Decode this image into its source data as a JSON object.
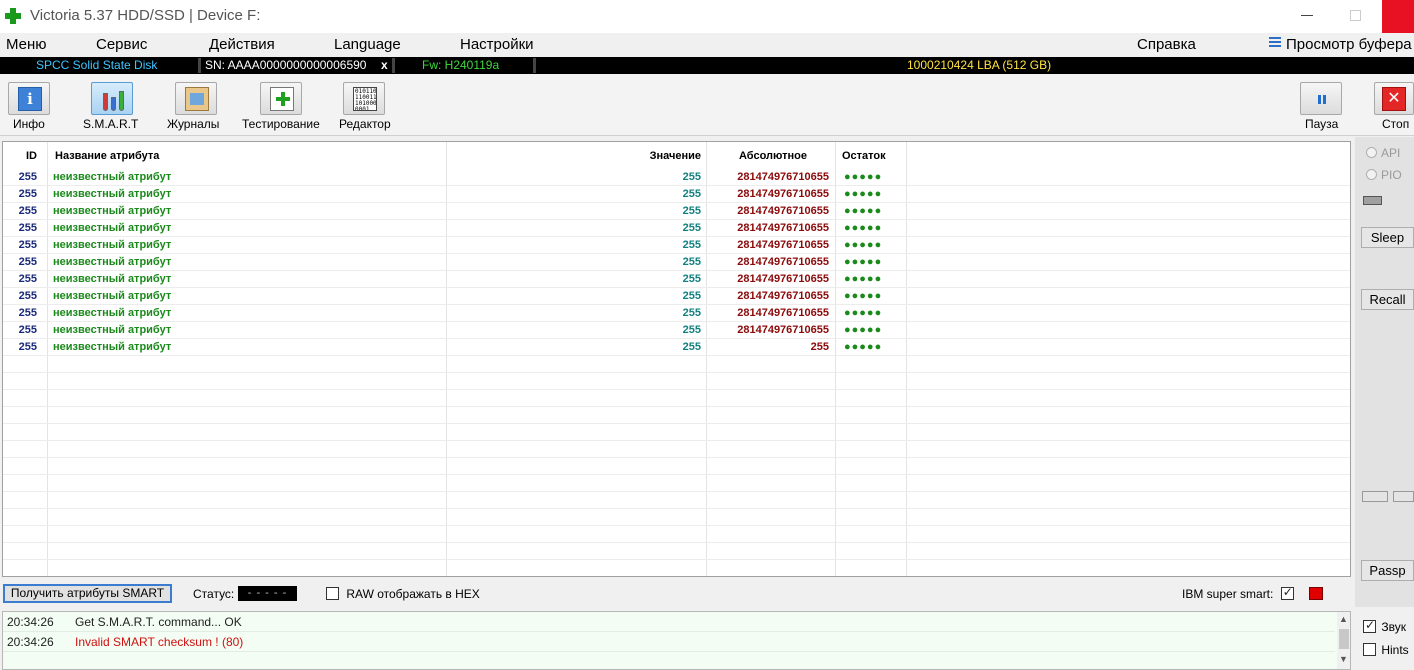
{
  "window": {
    "title": "Victoria 5.37 HDD/SSD | Device F:"
  },
  "menu": {
    "items": [
      "Меню",
      "Сервис",
      "Действия",
      "Language",
      "Настройки",
      "Справка"
    ],
    "buffer_view": "Просмотр буфера"
  },
  "device": {
    "model": "SPCC Solid State Disk",
    "serial": "SN: AAAA0000000000006590",
    "close": "x",
    "firmware": "Fw: H240119a",
    "capacity": "1000210424 LBA (512 GB)"
  },
  "toolbar": {
    "info": "Инфо",
    "smart": "S.M.A.R.T",
    "journals": "Журналы",
    "testing": "Тестирование",
    "editor": "Редактор",
    "pause": "Пауза",
    "stop": "Стоп",
    "info_glyph": "i",
    "editor_glyph": "010110 110011 101000 0001",
    "stop_glyph": "✕"
  },
  "table": {
    "headers": {
      "id": "ID",
      "name": "Название атрибута",
      "value": "Значение",
      "absolute": "Абсолютное",
      "remainder": "Остаток"
    },
    "rows": [
      {
        "id": "255",
        "name": "неизвестный атрибут",
        "value": "255",
        "absolute": "281474976710655",
        "remainder": "●●●●●"
      },
      {
        "id": "255",
        "name": "неизвестный атрибут",
        "value": "255",
        "absolute": "281474976710655",
        "remainder": "●●●●●"
      },
      {
        "id": "255",
        "name": "неизвестный атрибут",
        "value": "255",
        "absolute": "281474976710655",
        "remainder": "●●●●●"
      },
      {
        "id": "255",
        "name": "неизвестный атрибут",
        "value": "255",
        "absolute": "281474976710655",
        "remainder": "●●●●●"
      },
      {
        "id": "255",
        "name": "неизвестный атрибут",
        "value": "255",
        "absolute": "281474976710655",
        "remainder": "●●●●●"
      },
      {
        "id": "255",
        "name": "неизвестный атрибут",
        "value": "255",
        "absolute": "281474976710655",
        "remainder": "●●●●●"
      },
      {
        "id": "255",
        "name": "неизвестный атрибут",
        "value": "255",
        "absolute": "281474976710655",
        "remainder": "●●●●●"
      },
      {
        "id": "255",
        "name": "неизвестный атрибут",
        "value": "255",
        "absolute": "281474976710655",
        "remainder": "●●●●●"
      },
      {
        "id": "255",
        "name": "неизвестный атрибут",
        "value": "255",
        "absolute": "281474976710655",
        "remainder": "●●●●●"
      },
      {
        "id": "255",
        "name": "неизвестный атрибут",
        "value": "255",
        "absolute": "281474976710655",
        "remainder": "●●●●●"
      },
      {
        "id": "255",
        "name": "неизвестный атрибут",
        "value": "255",
        "absolute": "255",
        "remainder": "●●●●●"
      }
    ]
  },
  "right_panel": {
    "api": "API",
    "pio": "PIO",
    "sleep": "Sleep",
    "recall": "Recall",
    "passp": "Passp"
  },
  "controls": {
    "get_smart": "Получить атрибуты SMART",
    "status_label": "Статус:",
    "status_value": "- - - - -",
    "raw_hex": "RAW отображать в HEX",
    "raw_hex_checked": false,
    "ibm_super_smart": "IBM super smart:",
    "ibm_checked": true
  },
  "log": [
    {
      "time": "20:34:26",
      "message": "Get S.M.A.R.T. command... OK",
      "color": "#222222"
    },
    {
      "time": "20:34:26",
      "message": "Invalid SMART checksum ! (80)",
      "color": "#d01010"
    }
  ],
  "options": {
    "sound": "Звук",
    "sound_checked": true,
    "hints": "Hints",
    "hints_checked": false
  },
  "colors": {
    "id": "#1a2a7a",
    "attribute_name": "#1a8a1a",
    "value": "#138080",
    "absolute": "#8b0a0a",
    "device_model": "#3ec6ff",
    "firmware": "#3ed63e",
    "capacity": "#ffe43e"
  }
}
